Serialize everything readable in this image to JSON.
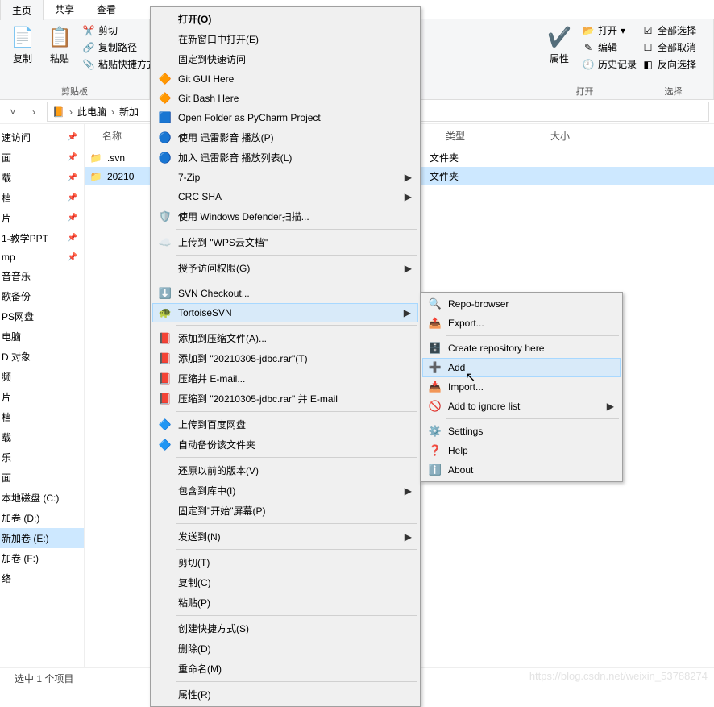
{
  "tabs": {
    "home": "主页",
    "share": "共享",
    "view": "查看"
  },
  "ribbon": {
    "clipboard": {
      "copy": "复制",
      "paste": "粘贴",
      "cut": "剪切",
      "copy_path": "复制路径",
      "paste_shortcut": "粘贴快捷方式",
      "label": "剪贴板"
    },
    "open_group": {
      "props": "属性",
      "open_btn": "打开",
      "edit": "编辑",
      "history": "历史记录",
      "label": "打开"
    },
    "select_group": {
      "select_all": "全部选择",
      "select_none": "全部取消",
      "invert": "反向选择",
      "label": "选择"
    }
  },
  "breadcrumb": {
    "this_pc": "此电脑",
    "drive": "新加"
  },
  "sidebar": {
    "items": [
      "速访问",
      "面",
      "载",
      "档",
      "片",
      "1-教学PPT",
      "mp",
      "音音乐",
      "歌备份",
      "PS网盘",
      "电脑",
      "D 对象",
      "频",
      "片",
      "档",
      "载",
      "乐",
      "面",
      "本地磁盘 (C:)",
      "加卷 (D:)",
      "新加卷 (E:)",
      "加卷 (F:)",
      "络"
    ],
    "selected_index": 20
  },
  "headers": {
    "name": "名称",
    "type": "类型",
    "size": "大小"
  },
  "files": [
    {
      "name": ".svn",
      "type": "文件夹",
      "selected": false
    },
    {
      "name": "20210",
      "type": "文件夹",
      "selected": true
    }
  ],
  "status": "选中 1 个项目",
  "context_menu_1": [
    {
      "t": "打开(O)",
      "bold": true
    },
    {
      "t": "在新窗口中打开(E)"
    },
    {
      "t": "固定到快速访问"
    },
    {
      "t": "Git GUI Here",
      "icon": "git"
    },
    {
      "t": "Git Bash Here",
      "icon": "git"
    },
    {
      "t": "Open Folder as PyCharm Project",
      "icon": "pycharm"
    },
    {
      "t": "使用 迅雷影音 播放(P)",
      "icon": "xunlei"
    },
    {
      "t": "加入 迅雷影音 播放列表(L)",
      "icon": "xunlei"
    },
    {
      "t": "7-Zip",
      "sub": true
    },
    {
      "t": "CRC SHA",
      "sub": true
    },
    {
      "t": "使用 Windows Defender扫描...",
      "icon": "defender"
    },
    {
      "sep": true
    },
    {
      "t": "上传到 \"WPS云文档\"",
      "icon": "wps"
    },
    {
      "sep": true
    },
    {
      "t": "授予访问权限(G)",
      "sub": true
    },
    {
      "sep": true
    },
    {
      "t": "SVN Checkout...",
      "icon": "svn-checkout"
    },
    {
      "t": "TortoiseSVN",
      "icon": "tortoise",
      "sub": true,
      "hover": true
    },
    {
      "sep": true
    },
    {
      "t": "添加到压缩文件(A)...",
      "icon": "rar"
    },
    {
      "t": "添加到 \"20210305-jdbc.rar\"(T)",
      "icon": "rar"
    },
    {
      "t": "压缩并 E-mail...",
      "icon": "rar"
    },
    {
      "t": "压缩到 \"20210305-jdbc.rar\" 并 E-mail",
      "icon": "rar"
    },
    {
      "sep": true
    },
    {
      "t": "上传到百度网盘",
      "icon": "baidu"
    },
    {
      "t": "自动备份该文件夹",
      "icon": "baidu"
    },
    {
      "sep": true
    },
    {
      "t": "还原以前的版本(V)"
    },
    {
      "t": "包含到库中(I)",
      "sub": true
    },
    {
      "t": "固定到\"开始\"屏幕(P)"
    },
    {
      "sep": true
    },
    {
      "t": "发送到(N)",
      "sub": true
    },
    {
      "sep": true
    },
    {
      "t": "剪切(T)"
    },
    {
      "t": "复制(C)"
    },
    {
      "t": "粘贴(P)"
    },
    {
      "sep": true
    },
    {
      "t": "创建快捷方式(S)"
    },
    {
      "t": "删除(D)"
    },
    {
      "t": "重命名(M)"
    },
    {
      "sep": true
    },
    {
      "t": "属性(R)"
    }
  ],
  "context_menu_2": [
    {
      "t": "Repo-browser",
      "icon": "repo"
    },
    {
      "t": "Export...",
      "icon": "export"
    },
    {
      "sep": true
    },
    {
      "t": "Create repository here",
      "icon": "create-repo"
    },
    {
      "t": "Add",
      "icon": "add",
      "hover": true
    },
    {
      "t": "Import...",
      "icon": "import"
    },
    {
      "t": "Add to ignore list",
      "icon": "ignore",
      "sub": true
    },
    {
      "sep": true
    },
    {
      "t": "Settings",
      "icon": "settings"
    },
    {
      "t": "Help",
      "icon": "help"
    },
    {
      "t": "About",
      "icon": "about"
    }
  ],
  "watermark": "https://blog.csdn.net/weixin_53788274"
}
